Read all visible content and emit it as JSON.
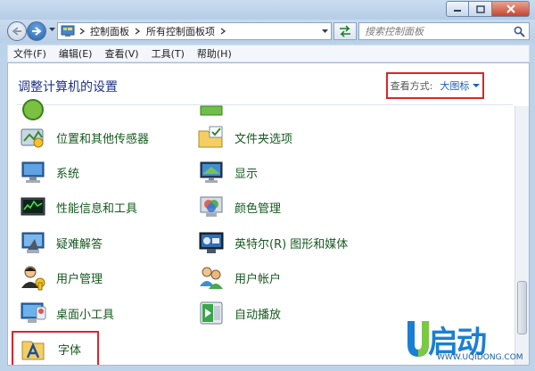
{
  "window": {
    "controls": [
      "minimize",
      "maximize",
      "close"
    ]
  },
  "address": {
    "crumbs": [
      "控制面板",
      "所有控制面板项"
    ],
    "search_placeholder": "搜索控制面板"
  },
  "menu": [
    "文件(F)",
    "编辑(E)",
    "查看(V)",
    "工具(T)",
    "帮助(H)"
  ],
  "header": {
    "title": "调整计算机的设置",
    "view_label": "查看方式:",
    "view_value": "大图标"
  },
  "items": [
    {
      "label": "位置和其他传感器",
      "icon": "location-sensor-icon"
    },
    {
      "label": "文件夹选项",
      "icon": "folder-options-icon"
    },
    {
      "label": "系统",
      "icon": "system-icon"
    },
    {
      "label": "显示",
      "icon": "display-icon"
    },
    {
      "label": "性能信息和工具",
      "icon": "performance-icon"
    },
    {
      "label": "颜色管理",
      "icon": "color-management-icon"
    },
    {
      "label": "疑难解答",
      "icon": "troubleshooting-icon"
    },
    {
      "label": "英特尔(R) 图形和媒体",
      "icon": "intel-graphics-icon"
    },
    {
      "label": "用户管理",
      "icon": "user-management-icon"
    },
    {
      "label": "用户帐户",
      "icon": "user-accounts-icon"
    },
    {
      "label": "桌面小工具",
      "icon": "desktop-gadgets-icon"
    },
    {
      "label": "自动播放",
      "icon": "autoplay-icon"
    },
    {
      "label": "字体",
      "icon": "fonts-icon"
    }
  ],
  "watermark": {
    "brand": "启动",
    "url": "WWW.UQIDONG.COM"
  },
  "colors": {
    "highlight_box": "#d9262c",
    "item_text": "#145a1e",
    "title_text": "#1e3287",
    "link": "#1c5fbf"
  }
}
